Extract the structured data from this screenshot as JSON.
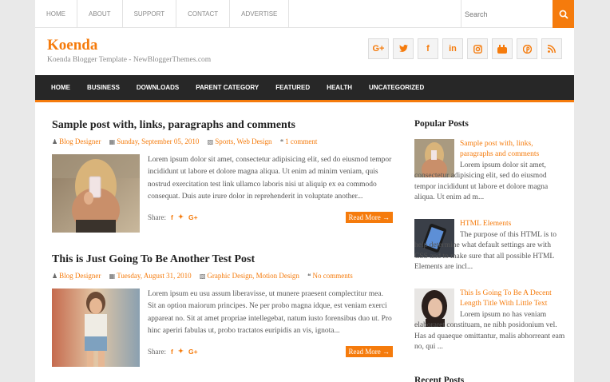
{
  "topnav": [
    "HOME",
    "ABOUT",
    "SUPPORT",
    "CONTACT",
    "ADVERTISE"
  ],
  "search": {
    "placeholder": "Search"
  },
  "header": {
    "title": "Koenda",
    "tagline": "Koenda Blogger Template - NewBloggerThemes.com"
  },
  "social": [
    "G+",
    "t",
    "f",
    "in",
    "ig",
    "yt",
    "p",
    "rss"
  ],
  "mainnav": [
    "HOME",
    "BUSINESS",
    "DOWNLOADS",
    "PARENT CATEGORY",
    "FEATURED",
    "HEALTH",
    "UNCATEGORIZED"
  ],
  "posts": [
    {
      "title": "Sample post with, links, paragraphs and comments",
      "author": "Blog Designer",
      "date": "Sunday, September 05, 2010",
      "labels": "Sports, Web Design",
      "comments": "1 comment",
      "excerpt": "Lorem ipsum dolor sit amet, consectetur adipisicing elit, sed do eiusmod tempor incididunt ut labore et dolore magna aliqua. Ut enim ad minim veniam, quis nostrud exercitation test link ullamco laboris nisi ut aliquip ex ea commodo consequat. Duis aute irure dolor in reprehenderit in voluptate another...",
      "share": "Share:",
      "more": "Read More →"
    },
    {
      "title": "This is Just Going To Be Another Test Post",
      "author": "Blog Designer",
      "date": "Tuesday, August 31, 2010",
      "labels": "Graphic Design, Motion Design",
      "comments": "No comments",
      "excerpt": "Lorem ipsum eu usu assum liberavisse, ut munere praesent complectitur mea. Sit an option maiorum principes. Ne per probo magna idque, est veniam exerci appareat no. Sit at amet propriae intellegebat, natum iusto forensibus duo ut. Pro hinc aperiri fabulas ut, probo tractatos euripidis an vis, ignota...",
      "share": "Share:",
      "more": "Read More →"
    }
  ],
  "sidebar": {
    "popular_title": "Popular Posts",
    "recent_title": "Recent Posts",
    "popular": [
      {
        "title": "Sample post with, links, paragraphs and comments",
        "snippet": "Lorem ipsum dolor sit amet, consectetur adipisicing elit, sed do eiusmod tempor incididunt ut labore et dolore magna aliqua. Ut enim ad m..."
      },
      {
        "title": "HTML Elements",
        "snippet": "The purpose of this HTML is to help determine what default settings are with CSS and to make sure that all possible HTML Elements are incl..."
      },
      {
        "title": "This Is Going To Be A Decent Length Title With Little Text",
        "snippet": "Lorem ipsum no has veniam elaboraret constituam, ne nibh posidonium vel. Has ad quaeque omittantur, malis abhorreant eam no, qui ..."
      }
    ]
  },
  "colors": {
    "accent": "#f57b0c",
    "nav_bg": "#272727"
  }
}
